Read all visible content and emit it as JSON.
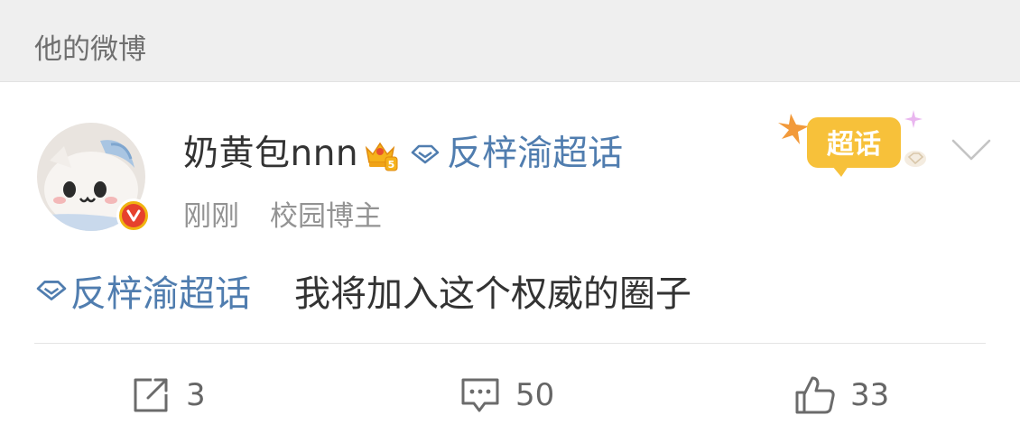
{
  "header": {
    "title": "他的微博"
  },
  "post": {
    "username": "奶黄包nnn",
    "user_topic": "反梓渝超话",
    "badge_text": "超话",
    "time": "刚刚",
    "user_tag": "校园博主",
    "topic_tag": "反梓渝超话",
    "text": "我将加入这个权威的圈子",
    "icons": {
      "avatar": "avatar-image",
      "verified": "verified-badge-icon",
      "crown": "crown-level-icon",
      "topic": "super-topic-diamond-icon",
      "more": "chevron-down-icon",
      "repost": "repost-icon",
      "comment": "comment-icon",
      "like": "thumbs-up-icon"
    },
    "colors": {
      "link": "#507daf",
      "text": "#333333",
      "muted": "#939393",
      "badge": "#f7c13a"
    }
  },
  "actions": {
    "repost_count": "3",
    "comment_count": "50",
    "like_count": "33"
  }
}
